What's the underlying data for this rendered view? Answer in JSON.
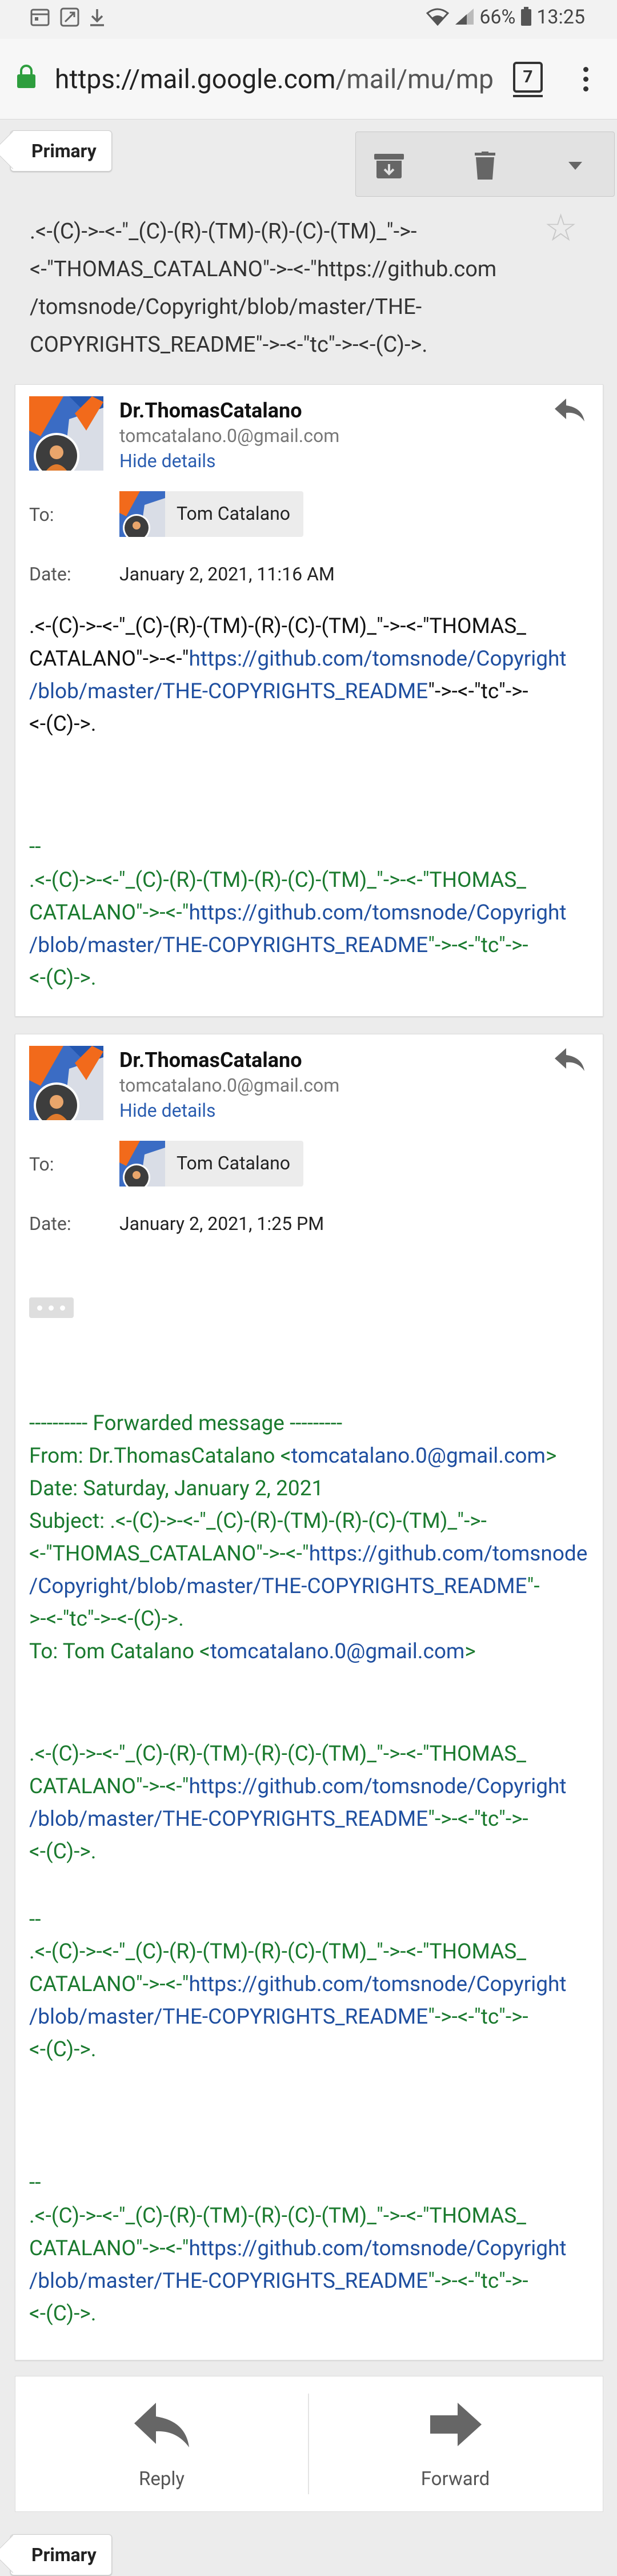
{
  "status_bar": {
    "battery": "66%",
    "time": "13:25"
  },
  "browser": {
    "url_host": "https://mail.google.com",
    "url_path": "/mail/mu/mp",
    "tab_count": "7"
  },
  "label_tab": "Primary",
  "thread": {
    "subject_lines": [
      ".<-(C)->-<-\"_(C)-(R)-(TM)-(R)-(C)-(TM)_\"->-",
      "<-\"THOMAS_CATALANO\"->-<-\"https://github.com",
      "/tomsnode/Copyright/blob/master/THE-",
      "COPYRIGHTS_README\"->-<-\"tc\"->-<-(C)->."
    ]
  },
  "messages": [
    {
      "sender": "Dr.ThomasCatalano",
      "email": "tomcatalano.0@gmail.com",
      "hide_details": "Hide details",
      "to_label": "To:",
      "to_name": "Tom Catalano",
      "date_label": "Date:",
      "date": "January 2, 2021, 11:16 AM",
      "body": [
        [
          {
            "t": ".<-(C)->-<-\"_(C)-(R)-(TM)-(R)-(C)-(TM)_\"->-<-\"THOMAS_"
          }
        ],
        [
          {
            "t": "CATALANO\"->-<-\""
          },
          {
            "t": "https://github.com/tomsnode/Copyright",
            "link": true
          }
        ],
        [
          {
            "t": "/blob/master/THE-COPYRIGHTS_README",
            "link": true
          },
          {
            "t": "\"->-<-\"tc\"->-"
          }
        ],
        [
          {
            "t": "<-(C)->."
          }
        ]
      ],
      "sig_sep": "--",
      "signature": [
        [
          {
            "t": ".<-(C)->-<-\"_(C)-(R)-(TM)-(R)-(C)-(TM)_\"->-<-\"THOMAS_"
          }
        ],
        [
          {
            "t": "CATALANO\"->-<-\""
          },
          {
            "t": "https://github.com/tomsnode/Copyright",
            "link": true
          }
        ],
        [
          {
            "t": "/blob/master/THE-COPYRIGHTS_README",
            "link": true
          },
          {
            "t": "\"->-<-\"tc\"->-"
          }
        ],
        [
          {
            "t": "<-(C)->."
          }
        ]
      ]
    },
    {
      "sender": "Dr.ThomasCatalano",
      "email": "tomcatalano.0@gmail.com",
      "hide_details": "Hide details",
      "to_label": "To:",
      "to_name": "Tom Catalano",
      "date_label": "Date:",
      "date": "January 2, 2021, 1:25 PM",
      "forwarded": [
        [
          {
            "t": "---------- Forwarded message ---------"
          }
        ],
        [
          {
            "t": "From: Dr.ThomasCatalano <"
          },
          {
            "t": "tomcatalano.0@gmail.com",
            "link": true
          },
          {
            "t": ">"
          }
        ],
        [
          {
            "t": "Date: Saturday, January 2, 2021"
          }
        ],
        [
          {
            "t": "Subject: .<-(C)->-<-\"_(C)-(R)-(TM)-(R)-(C)-(TM)_\"->-"
          }
        ],
        [
          {
            "t": "<-\"THOMAS_CATALANO\"->-<-\""
          },
          {
            "t": "https://github.com/tomsnode",
            "link": true
          }
        ],
        [
          {
            "t": "/Copyright/blob/master/THE-COPYRIGHTS_README",
            "link": true
          },
          {
            "t": "\"-"
          }
        ],
        [
          {
            "t": ">-<-\"tc\"->-<-(C)->."
          }
        ],
        [
          {
            "t": "To: Tom Catalano <"
          },
          {
            "t": "tomcatalano.0@gmail.com",
            "link": true
          },
          {
            "t": ">"
          }
        ]
      ],
      "fwd_body": [
        [
          {
            "t": ".<-(C)->-<-\"_(C)-(R)-(TM)-(R)-(C)-(TM)_\"->-<-\"THOMAS_"
          }
        ],
        [
          {
            "t": "CATALANO\"->-<-\""
          },
          {
            "t": "https://github.com/tomsnode/Copyright",
            "link": true
          }
        ],
        [
          {
            "t": "/blob/master/THE-COPYRIGHTS_README",
            "link": true
          },
          {
            "t": "\"->-<-\"tc\"->-"
          }
        ],
        [
          {
            "t": "<-(C)->."
          }
        ]
      ],
      "sig_sep": "--",
      "signature_1": [
        [
          {
            "t": ".<-(C)->-<-\"_(C)-(R)-(TM)-(R)-(C)-(TM)_\"->-<-\"THOMAS_"
          }
        ],
        [
          {
            "t": "CATALANO\"->-<-\""
          },
          {
            "t": "https://github.com/tomsnode/Copyright",
            "link": true
          }
        ],
        [
          {
            "t": "/blob/master/THE-COPYRIGHTS_README",
            "link": true
          },
          {
            "t": "\"->-<-\"tc\"->-"
          }
        ],
        [
          {
            "t": "<-(C)->."
          }
        ]
      ],
      "signature_2": [
        [
          {
            "t": ".<-(C)->-<-\"_(C)-(R)-(TM)-(R)-(C)-(TM)_\"->-<-\"THOMAS_"
          }
        ],
        [
          {
            "t": "CATALANO\"->-<-\""
          },
          {
            "t": "https://github.com/tomsnode/Copyright",
            "link": true
          }
        ],
        [
          {
            "t": "/blob/master/THE-COPYRIGHTS_README",
            "link": true
          },
          {
            "t": "\"->-<-\"tc\"->-"
          }
        ],
        [
          {
            "t": "<-(C)->."
          }
        ]
      ]
    }
  ],
  "actions": {
    "reply": "Reply",
    "forward": "Forward"
  },
  "icons": {
    "archive": "archive-icon",
    "delete": "trash-icon",
    "more": "dropdown-icon",
    "star": "star-icon",
    "reply": "reply-icon",
    "forward": "forward-icon"
  },
  "colors": {
    "link": "#1f4fa0",
    "quoted_green": "#1a7a2e",
    "lock_green": "#2e9e3e"
  }
}
